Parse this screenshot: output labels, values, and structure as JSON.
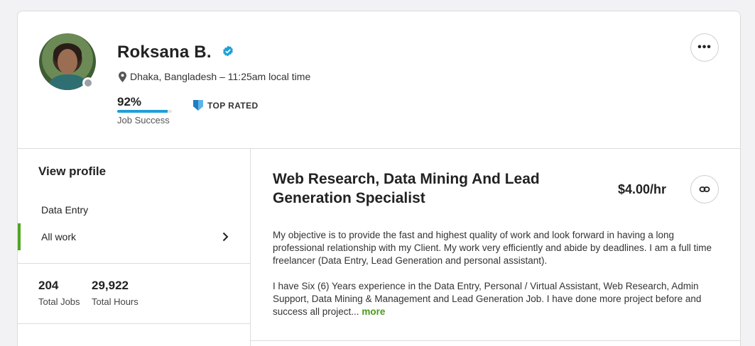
{
  "profile": {
    "name": "Roksana B.",
    "location": "Dhaka, Bangladesh – 11:25am local time",
    "job_success_pct": "92%",
    "job_success_value": 0.92,
    "job_success_label": "Job Success",
    "top_rated_label": "TOP RATED",
    "more_options": "•••"
  },
  "sidebar": {
    "view_profile": "View profile",
    "items": [
      {
        "label": "Data Entry"
      },
      {
        "label": "All work"
      }
    ],
    "stats": [
      {
        "value": "204",
        "label": "Total Jobs"
      },
      {
        "value": "29,922",
        "label": "Total Hours"
      }
    ]
  },
  "main": {
    "title": "Web Research, Data Mining And Lead Generation Specialist",
    "rate": "$4.00/hr",
    "overview_p1": "My objective is to provide the fast and highest quality of work and look forward in having a long professional relationship with my Client. My work very efficiently and abide by deadlines. I am a full time freelancer (Data Entry, Lead Generation and personal assistant).",
    "overview_p2": "I have Six (6) Years experience in the Data Entry, Personal / Virtual Assistant, Web Research, Admin Support, Data Mining & Management and Lead Generation Job. I have done more project before and success all project...",
    "more_label": "more"
  },
  "colors": {
    "accent_green": "#4fa521",
    "progress_blue": "#1f9fd6",
    "verified_blue": "#1f9fd6",
    "badge_blue": "#1f7ec4"
  }
}
